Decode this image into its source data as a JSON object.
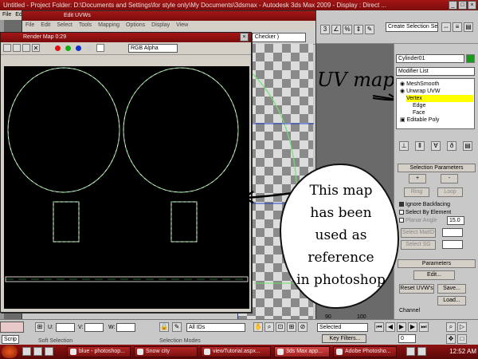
{
  "titlebar": {
    "text": "Untitled  - Project Folder: D:\\Documents and Settings\\for style only\\My Documents\\3dsmax  - Autodesk 3ds Max  2009    - Display : Direct ..."
  },
  "menubar": {
    "items": [
      "File",
      "Edit"
    ]
  },
  "uv_editor": {
    "title": "Edit UVWs",
    "menu": [
      "File",
      "Edit",
      "Select",
      "Tools",
      "Mapping",
      "Options",
      "Display",
      "View"
    ],
    "pattern_select": "Pattern ( Checker )"
  },
  "render_map": {
    "title": "Render Map 0:29",
    "channel_select": "RGB Alpha",
    "colors": {
      "red": "#e01010",
      "green": "#10b010",
      "blue": "#1030d0",
      "grey": "#cccccc"
    }
  },
  "toolbar": {
    "selection_set": "Create Selection Set",
    "view_select": "View"
  },
  "command_panel": {
    "object_name": "Cylinder01",
    "modifier_list": "Modifier List",
    "stack": [
      "MeshSmooth",
      "Unwrap UVW",
      "Vertex",
      "Edge",
      "Face",
      "Editable Poly"
    ],
    "selection_parameters": "Selection Parameters",
    "plus": "+",
    "minus": "-",
    "ring": "Ring",
    "loop": "Loop",
    "ignore_backfacing": "Ignore Backfacing",
    "select_by_element": "Select By Element",
    "planar_angle": "Planar Angle",
    "planar_angle_value": "15.0",
    "select_matid": "Select MatID",
    "select_sg": "Select SG",
    "parameters": "Parameters",
    "edit_button": "Edit...",
    "reset_uvws": "Reset UVW's",
    "save": "Save...",
    "load": "Load...",
    "channel": "Channel"
  },
  "uv_bottom": {
    "u_label": "U:",
    "v_label": "V:",
    "w_label": "W:",
    "ids_select": "All IDs",
    "soft_selection": "Soft Selection",
    "selection_modes": "Selection Modes"
  },
  "status": {
    "scrip": "Scrip",
    "selected": "Selected",
    "key_filters": "Key Filters...",
    "frame_value": "0",
    "timeline_tick": "90",
    "timeline_tick_2": "100"
  },
  "taskbar": {
    "tasks": [
      "blue - photoshop...",
      "Snow city",
      "viewTutorial.aspx...",
      "3ds Max app...",
      "Adobe Photosho..."
    ],
    "clock": "12:52 AM"
  },
  "annotation": {
    "uv_map_label": "UV map",
    "bubble_lines": [
      "This map",
      "has been",
      "used as",
      "reference",
      "in photoshop"
    ]
  }
}
